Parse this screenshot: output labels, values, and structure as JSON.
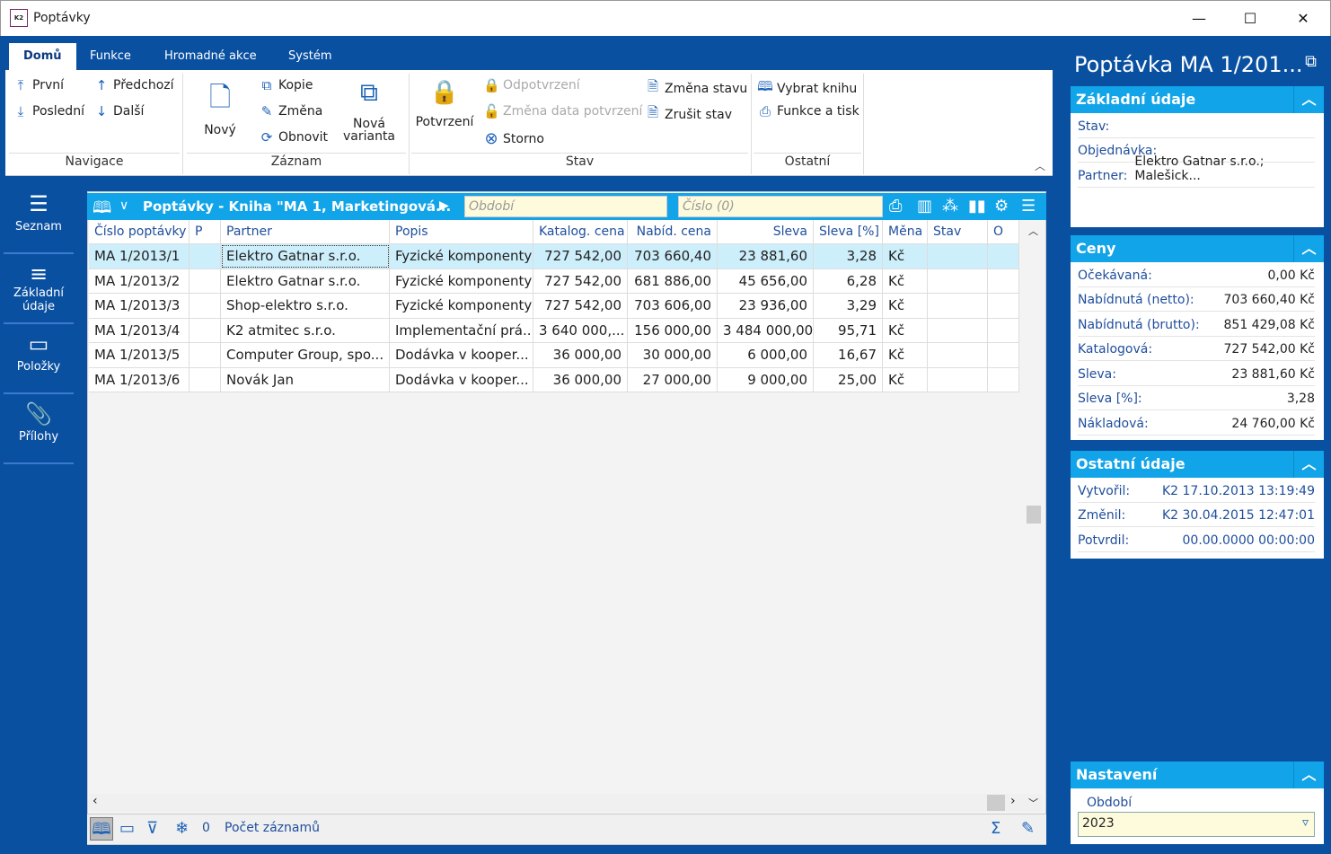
{
  "window": {
    "title": "Poptávky",
    "logo": "K2",
    "minimize": "—",
    "maximize": "☐",
    "close": "✕"
  },
  "ribbon": {
    "tabs": [
      "Domů",
      "Funkce",
      "Hromadné akce",
      "Systém"
    ],
    "navigace": {
      "label": "Navigace",
      "items": [
        "První",
        "Poslední",
        "Předchozí",
        "Další"
      ]
    },
    "zaznam": {
      "label": "Záznam",
      "novy": "Nový",
      "kopie": "Kopie",
      "zmena": "Změna",
      "obnovit": "Obnovit",
      "nova1": "Nová",
      "nova2": "varianta"
    },
    "stav": {
      "label": "Stav",
      "potvrzeni": "Potvrzení",
      "odpotvrzeni": "Odpotvrzení",
      "zmena_data": "Změna data potvrzení",
      "storno": "Storno",
      "zmena_stavu": "Změna stavu",
      "zrusit_stav": "Zrušit stav"
    },
    "ostatni": {
      "label": "Ostatní",
      "vybrat_knihu": "Vybrat knihu",
      "funkce_tisk": "Funkce a tisk"
    }
  },
  "leftnav": [
    {
      "label": "Seznam",
      "icon": "list-icon"
    },
    {
      "label": "Základní údaje",
      "icon": "details-icon"
    },
    {
      "label": "Položky",
      "icon": "box-icon"
    },
    {
      "label": "Přílohy",
      "icon": "paperclip-icon"
    }
  ],
  "grid": {
    "title": "Poptávky - Kniha \"MA 1, Marketingová...",
    "period_placeholder": "Období",
    "number_placeholder": "Číslo (0)",
    "columns": [
      "Číslo poptávky",
      "P",
      "Partner",
      "Popis",
      "Katalog. cena",
      "Nabíd. cena",
      "Sleva",
      "Sleva [%]",
      "Měna",
      "Stav",
      "O"
    ],
    "rows": [
      [
        "MA 1/2013/1",
        "",
        "Elektro Gatnar s.r.o.",
        "Fyzické komponenty",
        "727 542,00",
        "703 660,40",
        "23 881,60",
        "3,28",
        "Kč",
        "",
        ""
      ],
      [
        "MA 1/2013/2",
        "",
        "Elektro Gatnar s.r.o.",
        "Fyzické komponenty",
        "727 542,00",
        "681 886,00",
        "45 656,00",
        "6,28",
        "Kč",
        "",
        ""
      ],
      [
        "MA 1/2013/3",
        "",
        "Shop-elektro s.r.o.",
        "Fyzické komponenty",
        "727 542,00",
        "703 606,00",
        "23 936,00",
        "3,29",
        "Kč",
        "",
        ""
      ],
      [
        "MA 1/2013/4",
        "",
        "K2 atmitec s.r.o.",
        "Implementační prá...",
        "3 640 000,...",
        "156 000,00",
        "3 484 000,00",
        "95,71",
        "Kč",
        "",
        ""
      ],
      [
        "MA 1/2013/5",
        "",
        "Computer Group, spo...",
        "Dodávka v kooper...",
        "36 000,00",
        "30 000,00",
        "6 000,00",
        "16,67",
        "Kč",
        "",
        ""
      ],
      [
        "MA 1/2013/6",
        "",
        "Novák Jan",
        "Dodávka v kooper...",
        "36 000,00",
        "27 000,00",
        "9 000,00",
        "25,00",
        "Kč",
        "",
        ""
      ]
    ],
    "footer": {
      "count": "0",
      "records_label": "Počet záznamů"
    }
  },
  "panel": {
    "title": "Poptávka MA 1/201...",
    "zakladni": {
      "header": "Základní údaje",
      "stav": "Stav:",
      "objednavka": "Objednávka:",
      "partner_label": "Partner:",
      "partner": "Elektro Gatnar s.r.o.; Malešick..."
    },
    "ceny": {
      "header": "Ceny",
      "rows": [
        [
          "Očekávaná:",
          "0,00 Kč"
        ],
        [
          "Nabídnutá (netto):",
          "703 660,40 Kč"
        ],
        [
          "Nabídnutá (brutto):",
          "851 429,08 Kč"
        ],
        [
          "Katalogová:",
          "727 542,00 Kč"
        ],
        [
          "Sleva:",
          "23 881,60 Kč"
        ],
        [
          "Sleva [%]:",
          "3,28"
        ],
        [
          "Nákladová:",
          "24 760,00 Kč"
        ]
      ]
    },
    "ostatni": {
      "header": "Ostatní údaje",
      "rows": [
        [
          "Vytvořil:",
          "K2 17.10.2013 13:19:49"
        ],
        [
          "Změnil:",
          "K2 30.04.2015 12:47:01"
        ],
        [
          "Potvrdil:",
          "00.00.0000 00:00:00"
        ]
      ]
    },
    "nastaveni": {
      "header": "Nastavení",
      "obdobi_label": "Období",
      "obdobi": "2023"
    }
  },
  "colors": {
    "frame": "#0a50a1",
    "accent": "#12a4e8",
    "selected_row": "#cdeefb",
    "label": "#1f4e9c"
  }
}
